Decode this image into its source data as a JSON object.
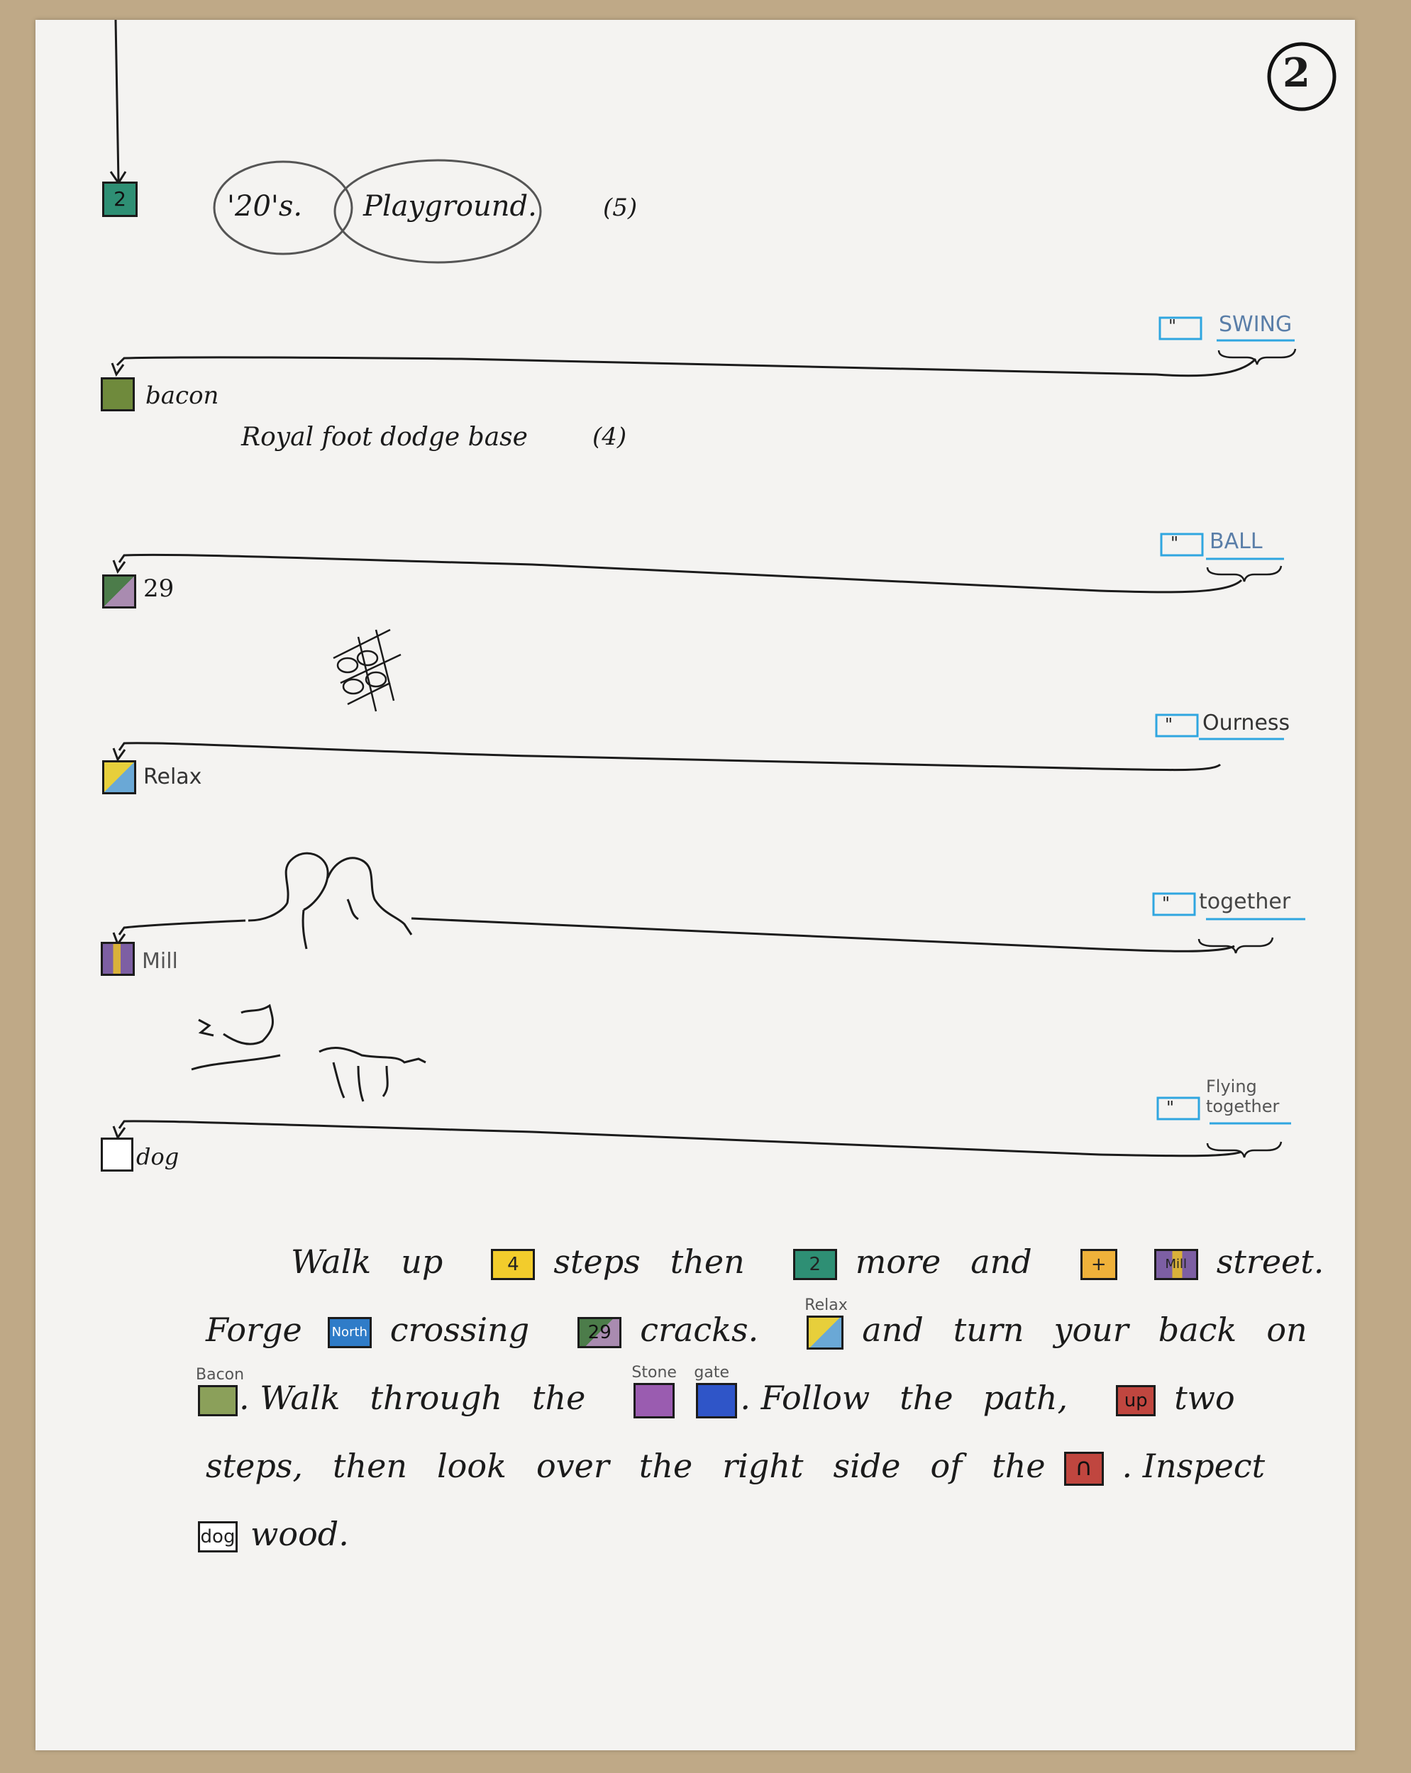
{
  "page_number": "2",
  "header": {
    "start_square_label": "2",
    "venn_left": "'20's.",
    "venn_right": "Playground.",
    "count": "(5)"
  },
  "rows": [
    {
      "clue_label": "\"",
      "answer": "SWING",
      "square_label": "bacon",
      "square_color": "#6f8a3c",
      "note": "Royal foot dodge base",
      "note_count": "(4)"
    },
    {
      "clue_label": "\"",
      "answer": "BALL",
      "square_label": "29",
      "square_color_a": "#4c7c4a",
      "square_color_b": "#a98bb0"
    },
    {
      "clue_label": "\"",
      "answer": "Ourness",
      "square_label": "Relax",
      "square_color_a": "#e7cf3b",
      "square_color_b": "#6aa8d6"
    },
    {
      "clue_label": "\"",
      "answer": "together",
      "square_label": "Mill",
      "square_color_a": "#7d5fa3",
      "square_color_b": "#d9b13a"
    },
    {
      "clue_label": "\"",
      "answer": "Flying together",
      "square_label": "dog",
      "square_color": "#ffffff"
    }
  ],
  "paragraph": {
    "line1": {
      "w1": "Walk",
      "w2": "up",
      "box1": "4",
      "w3": "steps",
      "w4": "then",
      "box2": "2",
      "w5": "more",
      "w6": "and",
      "box3": "+",
      "box4": "Mill",
      "w7": "street."
    },
    "line2": {
      "w1": "Forge",
      "box1": "North",
      "w2": "crossing",
      "box2": "29",
      "w3": "cracks.",
      "box3_over": "Relax",
      "w4": "and",
      "w5": "turn",
      "w6": "your",
      "w7": "back",
      "w8": "on"
    },
    "line3": {
      "box1_over": "Bacon",
      "w1": ". Walk",
      "w2": "through",
      "w3": "the",
      "box2_over": "Stone",
      "box3_over": "gate",
      "w4": ". Follow",
      "w5": "the",
      "w6": "path,",
      "box4": "up",
      "w7": "two"
    },
    "line4": {
      "w1": "steps,",
      "w2": "then",
      "w3": "look",
      "w4": "over",
      "w5": "the",
      "w6": "right",
      "w7": "side",
      "w8": "of",
      "w9": "the",
      "box1": "∩",
      "w10": ". Inspect"
    },
    "line5": {
      "box1": "dog",
      "w1": "wood."
    }
  },
  "colors": {
    "ink": "#1b1b1b",
    "blue_marker": "#2fa6e0",
    "teal": "#2e8f74",
    "yellow": "#f2cc2c",
    "orange": "#efb13a",
    "navy": "#2f55b8",
    "green": "#6f8a3c",
    "purple": "#8a5aa3",
    "red": "#c0463f"
  }
}
